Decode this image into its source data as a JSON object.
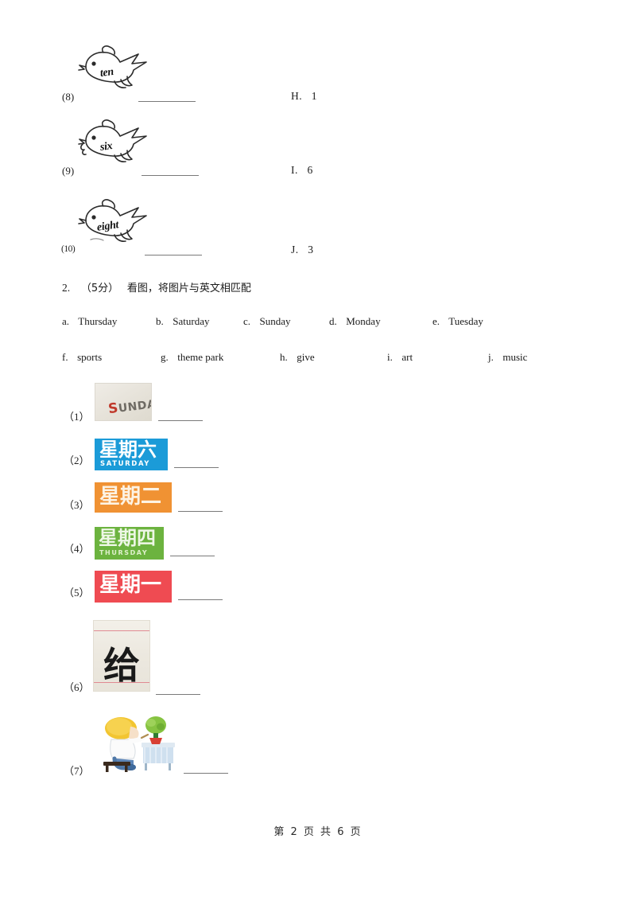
{
  "document": {
    "footer": "第 2 页 共 6 页"
  },
  "question1_continued": {
    "items": [
      {
        "num": "(8)",
        "word": "ten",
        "icon": "bird-icon",
        "blank": ""
      },
      {
        "num": "(9)",
        "word": "six",
        "icon": "bird-icon",
        "blank": ""
      },
      {
        "num": "(10)",
        "word": "eight",
        "icon": "bird-icon",
        "blank": ""
      }
    ],
    "right_options": [
      {
        "label": "H.",
        "value": "1"
      },
      {
        "label": "I.",
        "value": "6"
      },
      {
        "label": "J.",
        "value": "3"
      }
    ]
  },
  "question2": {
    "number": "2.",
    "score": "（5分）",
    "prompt": "看图，将图片与英文相匹配",
    "options_row1": [
      {
        "key": "a.",
        "label": "Thursday"
      },
      {
        "key": "b.",
        "label": "Saturday"
      },
      {
        "key": "c.",
        "label": "Sunday"
      },
      {
        "key": "d.",
        "label": "Monday"
      },
      {
        "key": "e.",
        "label": "Tuesday"
      }
    ],
    "options_row2": [
      {
        "key": "f.",
        "label": "sports"
      },
      {
        "key": "g.",
        "label": "theme park"
      },
      {
        "key": "h.",
        "label": "give"
      },
      {
        "key": "i.",
        "label": "art"
      },
      {
        "key": "j.",
        "label": "music"
      }
    ],
    "items": [
      {
        "num": "（1）",
        "image": "sunday-photo-card",
        "cn": "",
        "en": "SUNDAY",
        "bg": "#e9e5dc",
        "blank": ""
      },
      {
        "num": "（2）",
        "image": "saturday-card",
        "cn": "星期六",
        "en": "SATURDAY",
        "bg": "#1b9bd8",
        "blank": ""
      },
      {
        "num": "（3）",
        "image": "tuesday-card",
        "cn": "星期二",
        "en": "",
        "bg": "#f09233",
        "blank": ""
      },
      {
        "num": "（4）",
        "image": "thursday-card",
        "cn": "星期四",
        "en": "THURSDAY",
        "bg": "#6cb33f",
        "blank": ""
      },
      {
        "num": "（5）",
        "image": "monday-card",
        "cn": "星期一",
        "en": "",
        "bg": "#ef4b52",
        "blank": ""
      },
      {
        "num": "（6）",
        "image": "calligraphy-give",
        "cn": "给",
        "en": "",
        "bg": "#edE9e0",
        "blank": ""
      },
      {
        "num": "（7）",
        "image": "art-painting-clipart",
        "cn": "",
        "en": "",
        "bg": "#ffffff",
        "blank": ""
      }
    ]
  },
  "colors": {
    "saturday": "#1b9bd8",
    "tuesday": "#f09233",
    "thursday": "#6cb33f",
    "monday": "#ef4b52",
    "calligraphy_rule": "#e08a93",
    "ink": "#1a1a1a"
  }
}
